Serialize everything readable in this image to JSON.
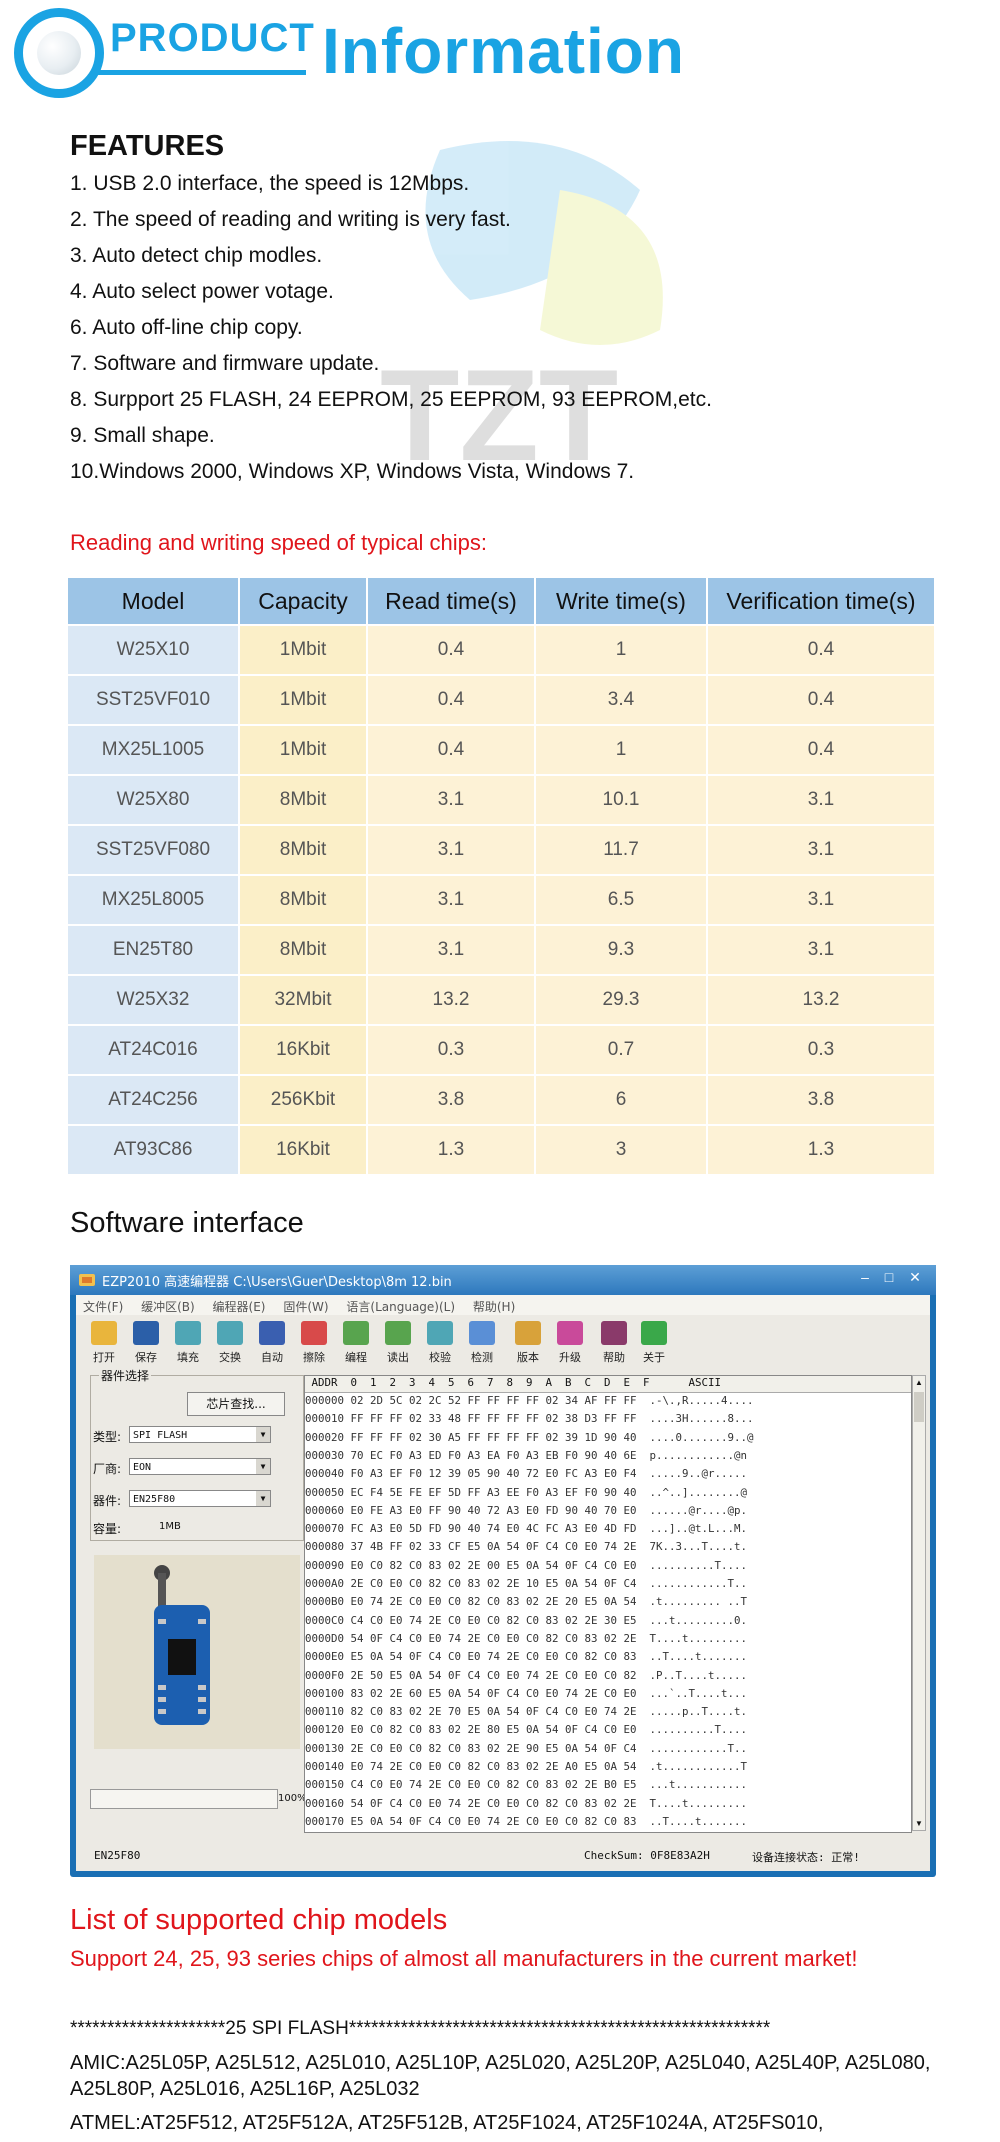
{
  "header": {
    "product": "PRODUCT",
    "information": "Information"
  },
  "features": {
    "title": "FEATURES",
    "items": [
      "1. USB 2.0 interface, the speed is 12Mbps.",
      "2. The speed of reading and writing is very fast.",
      "3. Auto detect chip modles.",
      "4. Auto select power votage.",
      "6. Auto off-line chip copy.",
      "7. Software and firmware update.",
      "8. Surpport 25 FLASH, 24 EEPROM, 25 EEPROM, 93 EEPROM,etc.",
      "9. Small shape.",
      "10.Windows 2000, Windows XP, Windows Vista, Windows 7."
    ]
  },
  "speed_heading": "Reading and writing speed of typical chips:",
  "speed_table": {
    "headers": [
      "Model",
      "Capacity",
      "Read time(s)",
      "Write time(s)",
      "Verification time(s)"
    ],
    "rows": [
      [
        "W25X10",
        "1Mbit",
        "0.4",
        "1",
        "0.4"
      ],
      [
        "SST25VF010",
        "1Mbit",
        "0.4",
        "3.4",
        "0.4"
      ],
      [
        "MX25L1005",
        "1Mbit",
        "0.4",
        "1",
        "0.4"
      ],
      [
        "W25X80",
        "8Mbit",
        "3.1",
        "10.1",
        "3.1"
      ],
      [
        "SST25VF080",
        "8Mbit",
        "3.1",
        "11.7",
        "3.1"
      ],
      [
        "MX25L8005",
        "8Mbit",
        "3.1",
        "6.5",
        "3.1"
      ],
      [
        "EN25T80",
        "8Mbit",
        "3.1",
        "9.3",
        "3.1"
      ],
      [
        "W25X32",
        "32Mbit",
        "13.2",
        "29.3",
        "13.2"
      ],
      [
        "AT24C016",
        "16Kbit",
        "0.3",
        "0.7",
        "0.3"
      ],
      [
        "AT24C256",
        "256Kbit",
        "3.8",
        "6",
        "3.8"
      ],
      [
        "AT93C86",
        "16Kbit",
        "1.3",
        "3",
        "1.3"
      ]
    ]
  },
  "software": {
    "title": "Software interface",
    "window_title": "EZP2010 高速编程器   C:\\Users\\Guer\\Desktop\\8m 12.bin",
    "menu": [
      "文件(F)",
      "缓冲区(B)",
      "编程器(E)",
      "固件(W)",
      "语言(Language)(L)",
      "帮助(H)"
    ],
    "tools": [
      "打开",
      "保存",
      "填充",
      "交换",
      "自动",
      "擦除",
      "编程",
      "读出",
      "校验",
      "检测",
      "版本",
      "升级",
      "帮助",
      "关于"
    ],
    "chip_group": "器件选择",
    "find_button": "芯片查找...",
    "type_label": "类型:",
    "type_value": "SPI FLASH",
    "vendor_label": "厂商:",
    "vendor_value": "EON",
    "device_label": "器件:",
    "device_value": "EN25F80",
    "capacity_label": "容量:",
    "capacity_value": "1MB",
    "progress_pct": "100%",
    "hex_header": " ADDR  0  1  2  3  4  5  6  7  8  9  A  B  C  D  E  F      ASCII",
    "hex_rows": [
      "000000 02 2D 5C 02 2C 52 FF FF FF FF 02 34 AF FF FF  .-\\.,R.....4....",
      "000010 FF FF FF 02 33 48 FF FF FF FF 02 38 D3 FF FF  ....3H......8...",
      "000020 FF FF FF 02 30 A5 FF FF FF FF 02 39 1D 90 40  ....0.......9..@",
      "000030 70 EC F0 A3 ED F0 A3 EA F0 A3 EB F0 90 40 6E  p............@n",
      "000040 F0 A3 EF F0 12 39 05 90 40 72 E0 FC A3 E0 F4  .....9..@r.....",
      "000050 EC F4 5E FE EF 5D FF A3 EE F0 A3 EF F0 90 40  ..^..]........@",
      "000060 E0 FE A3 E0 FF 90 40 72 A3 E0 FD 90 40 70 E0  ......@r....@p.",
      "000070 FC A3 E0 5D FD 90 40 74 E0 4C FC A3 E0 4D FD  ...]..@t.L...M.",
      "000080 37 4B FF 02 33 CF E5 0A 54 0F C4 C0 E0 74 2E  7K..3...T....t.",
      "000090 E0 C0 82 C0 83 02 2E 00 E5 0A 54 0F C4 C0 E0  ..........T....",
      "0000A0 2E C0 E0 C0 82 C0 83 02 2E 10 E5 0A 54 0F C4  ............T..",
      "0000B0 E0 74 2E C0 E0 C0 82 C0 83 02 2E 20 E5 0A 54  .t......... ..T",
      "0000C0 C4 C0 E0 74 2E C0 E0 C0 82 C0 83 02 2E 30 E5  ...t.........0.",
      "0000D0 54 0F C4 C0 E0 74 2E C0 E0 C0 82 C0 83 02 2E  T....t.........",
      "0000E0 E5 0A 54 0F C4 C0 E0 74 2E C0 E0 C0 82 C0 83  ..T....t.......",
      "0000F0 2E 50 E5 0A 54 0F C4 C0 E0 74 2E C0 E0 C0 82  .P..T....t.....",
      "000100 83 02 2E 60 E5 0A 54 0F C4 C0 E0 74 2E C0 E0  ...`..T....t...",
      "000110 82 C0 83 02 2E 70 E5 0A 54 0F C4 C0 E0 74 2E  .....p..T....t.",
      "000120 E0 C0 82 C0 83 02 2E 80 E5 0A 54 0F C4 C0 E0  ..........T....",
      "000130 2E C0 E0 C0 82 C0 83 02 2E 90 E5 0A 54 0F C4  ............T..",
      "000140 E0 74 2E C0 E0 C0 82 C0 83 02 2E A0 E5 0A 54  .t............T",
      "000150 C4 C0 E0 74 2E C0 E0 C0 82 C0 83 02 2E B0 E5  ...t...........",
      "000160 54 0F C4 C0 E0 74 2E C0 E0 C0 82 C0 83 02 2E  T....t.........",
      "000170 E5 0A 54 0F C4 C0 E0 74 2E C0 E0 C0 82 C0 83  ..T....t......."
    ],
    "status_device": "EN25F80",
    "status_checksum": "CheckSum: 0F8E83A2H",
    "status_connection": "设备连接状态: 正常!"
  },
  "supported": {
    "title": "List of supported chip models",
    "subtitle": "Support 24, 25, 93 series chips of almost all manufacturers in the current market!",
    "spi_line": "*********************25  SPI  FLASH*********************************************************",
    "amic": "AMIC:A25L05P, A25L512, A25L010, A25L10P, A25L020, A25L20P, A25L040, A25L40P, A25L080, A25L80P, A25L016, A25L16P, A25L032",
    "atmel": "ATMEL:AT25F512, AT25F512A, AT25F512B, AT25F1024, AT25F1024A, AT25FS010,"
  },
  "colors": {
    "brand_blue": "#1aa3e3",
    "red": "#e0151b",
    "header_blue": "#9cc4e6",
    "model_cell": "#dbe8f5",
    "value_cell": "#fbefc8"
  }
}
